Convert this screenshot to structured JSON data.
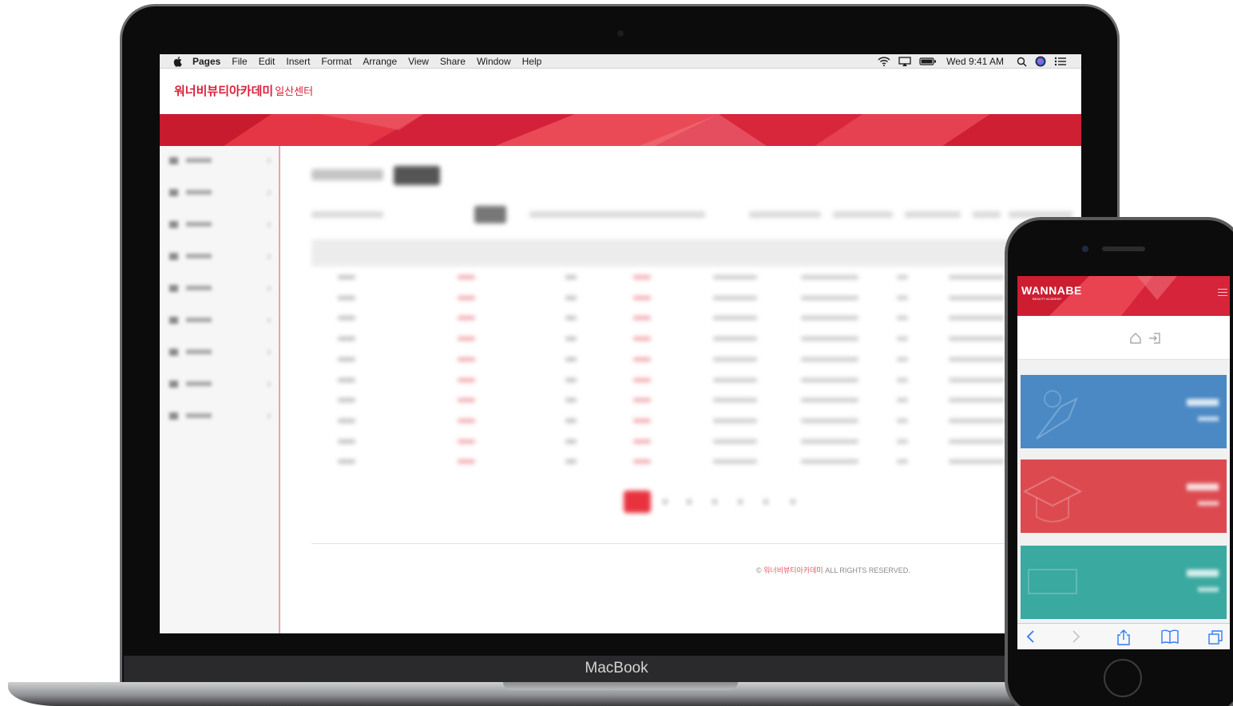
{
  "mac_menubar": {
    "app_name": "Pages",
    "items": [
      "File",
      "Edit",
      "Insert",
      "Format",
      "Arrange",
      "View",
      "Share",
      "Window",
      "Help"
    ],
    "clock": "Wed 9:41 AM",
    "status_icons": [
      "wifi-icon",
      "airplay-icon",
      "battery-icon",
      "spotlight-icon",
      "siri-icon",
      "notification-center-icon"
    ]
  },
  "site": {
    "brand_main": "워너비뷰티아카데미",
    "brand_sub": "일산센터",
    "accent_color": "#e02a3c"
  },
  "footer": {
    "copyright_symbol": "©",
    "copyright_brand": "워너비뷰티아카데미",
    "copyright_rest": "ALL RIGHTS RESERVED."
  },
  "laptop": {
    "label": "MacBook"
  },
  "phone": {
    "logo": "WANNABE",
    "logo_sub": "BEAUTY ACADEMY",
    "card_colors": [
      "#4a89c4",
      "#dc4a4f",
      "#3aa9a0"
    ],
    "toolbar_icons": [
      "back-icon",
      "forward-icon",
      "share-icon",
      "bookmarks-icon",
      "tabs-icon"
    ]
  }
}
